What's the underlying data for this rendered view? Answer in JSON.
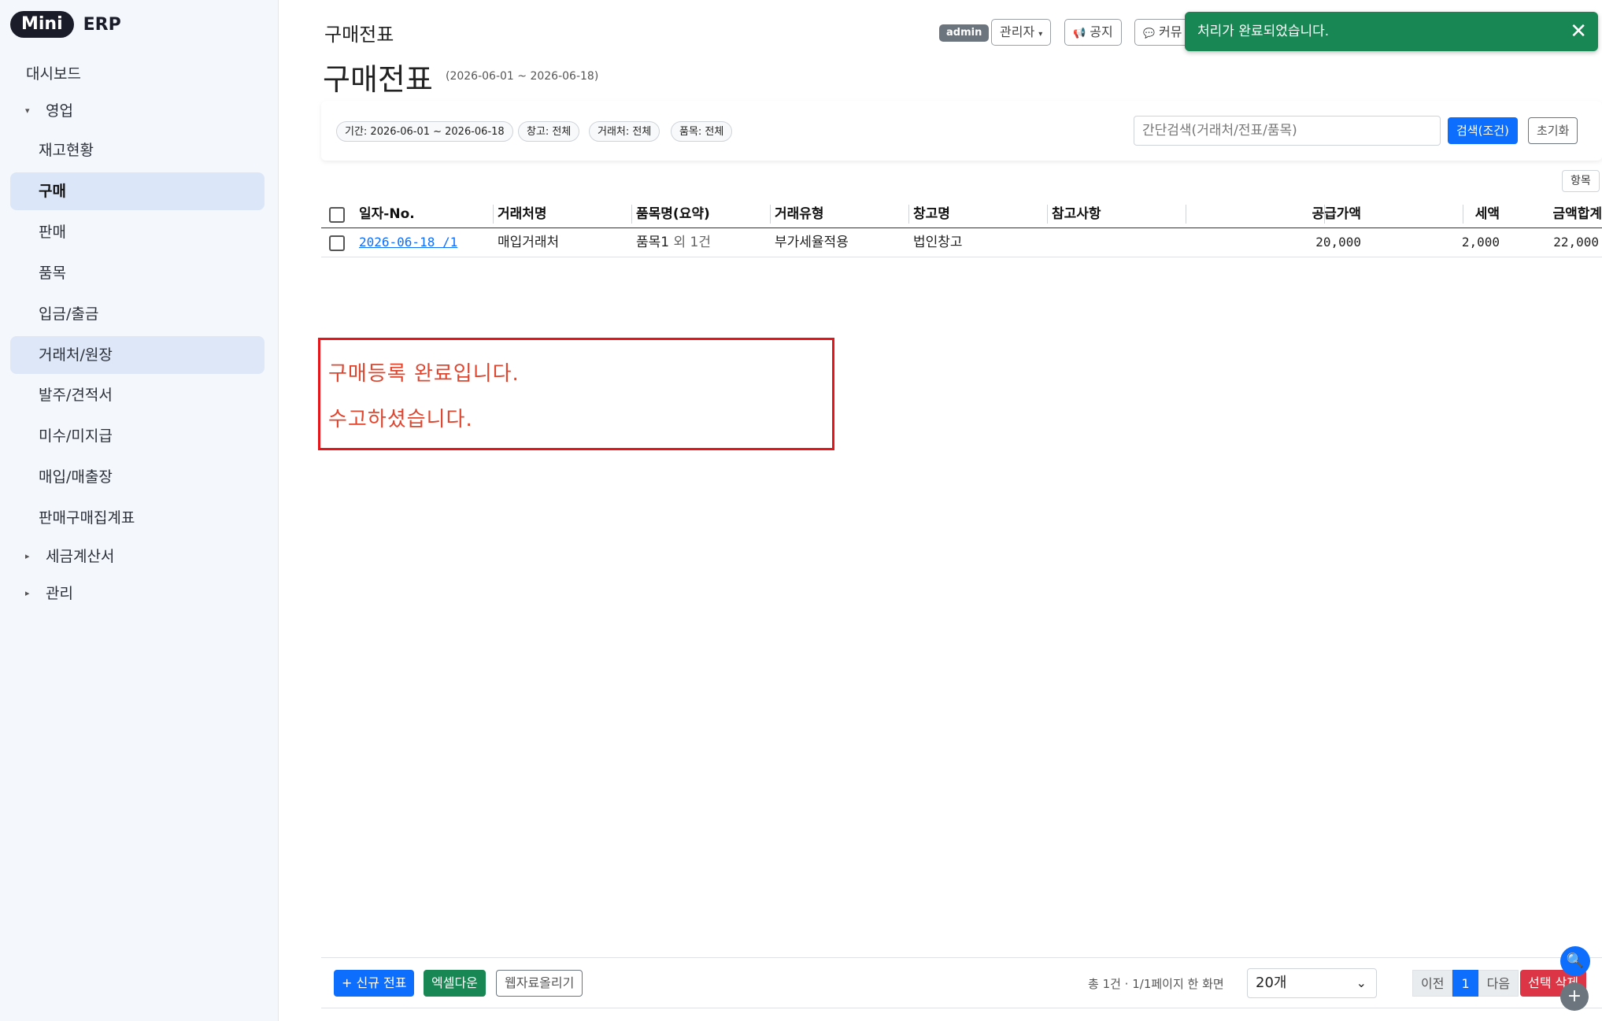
{
  "logo": {
    "pill": "Mini",
    "text": "ERP"
  },
  "sidebar": {
    "items": [
      {
        "label": "대시보드"
      },
      {
        "label": "영업"
      },
      {
        "label": "재고현황"
      },
      {
        "label": "구매"
      },
      {
        "label": "판매"
      },
      {
        "label": "품목"
      },
      {
        "label": "입금/출금"
      },
      {
        "label": "거래처/원장"
      },
      {
        "label": "발주/견적서"
      },
      {
        "label": "미수/미지급"
      },
      {
        "label": "매입/매출장"
      },
      {
        "label": "판매구매집계표"
      },
      {
        "label": "세금계산서"
      },
      {
        "label": "관리"
      }
    ]
  },
  "header": {
    "title_small": "구매전표",
    "title_big": "구매전표",
    "date_range": "(2026-06-01 ~ 2026-06-18)",
    "badge": "admin",
    "user_menu": "관리자",
    "notice_btn": "공지",
    "community_btn": "커뮤",
    "toast": "처리가 완료되었습니다."
  },
  "filters": {
    "chips": [
      "기간: 2026-06-01 ~ 2026-06-18",
      "창고: 전체",
      "거래처: 전체",
      "품목: 전체"
    ],
    "search_placeholder": "간단검색(거래처/전표/품목)",
    "search_btn": "검색(조건)",
    "reset_btn": "초기화",
    "items_btn": "항목"
  },
  "table": {
    "columns": [
      "일자-No.",
      "거래처명",
      "품목명(요약)",
      "거래유형",
      "창고명",
      "참고사항",
      "공급가액",
      "세액",
      "금액합계"
    ],
    "rows": [
      {
        "date_no": "2026-06-18 /1",
        "vendor": "매입거래처",
        "item": "품목1",
        "item_extra": "외 1건",
        "type": "부가세율적용",
        "warehouse": "법인창고",
        "note": "",
        "supply": "20,000",
        "tax": "2,000",
        "total": "22,000"
      }
    ]
  },
  "annotation": {
    "line1": "구매등록 완료입니다.",
    "line2": "수고하셨습니다."
  },
  "footer": {
    "new_btn": "+ 신규 전표",
    "excel_btn": "엑셀다운",
    "upload_btn": "웹자료올리기",
    "page_info": "총 1건 · 1/1페이지  한 화면",
    "page_size": "20개",
    "prev": "이전",
    "page": "1",
    "next": "다음",
    "delete_btn": "선택 삭제"
  }
}
